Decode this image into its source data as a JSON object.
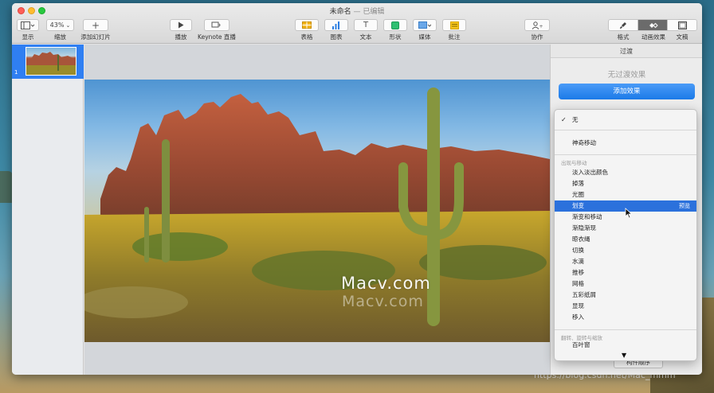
{
  "window": {
    "title": "未命名",
    "title_suffix": "— 已编辑"
  },
  "toolbar": {
    "view_label": "显示",
    "zoom_value": "43%",
    "zoom_label": "缩放",
    "add_slide_label": "添加幻灯片",
    "play_label": "播放",
    "keynote_live_label": "Keynote 直播",
    "table_label": "表格",
    "chart_label": "图表",
    "text_label": "文本",
    "shape_label": "形状",
    "media_label": "媒体",
    "comment_label": "批注",
    "collaborate_label": "协作",
    "format_label": "格式",
    "animate_label": "动画效果",
    "document_label": "文稿"
  },
  "navigator": {
    "slide_number": "1"
  },
  "slide": {
    "watermark": "Macv.com",
    "watermark_shadow": "Macv.com"
  },
  "inspector": {
    "tab": "过渡",
    "empty_text": "无过渡效果",
    "add_effect": "添加效果",
    "build_order": "构件顺序"
  },
  "menu": {
    "none": "无",
    "magic_move": "神奇移动",
    "section_header": "出现与移动",
    "items": [
      "淡入淡出颜色",
      "掉落",
      "光圈",
      "划变",
      "渐变和移动",
      "渐隐渐现",
      "晾衣绳",
      "切换",
      "水滴",
      "推移",
      "网格",
      "五彩纸屑",
      "显现",
      "移入"
    ],
    "highlighted_preview": "预览",
    "section2_header": "翻转、旋转与缩放",
    "partial_item": "百叶窗"
  },
  "desktop": {
    "url": "https://blog.csdn.net/Mac_mmm"
  },
  "colors": {
    "accent": "#2b71dc",
    "button_blue": "#1b7ae8"
  }
}
